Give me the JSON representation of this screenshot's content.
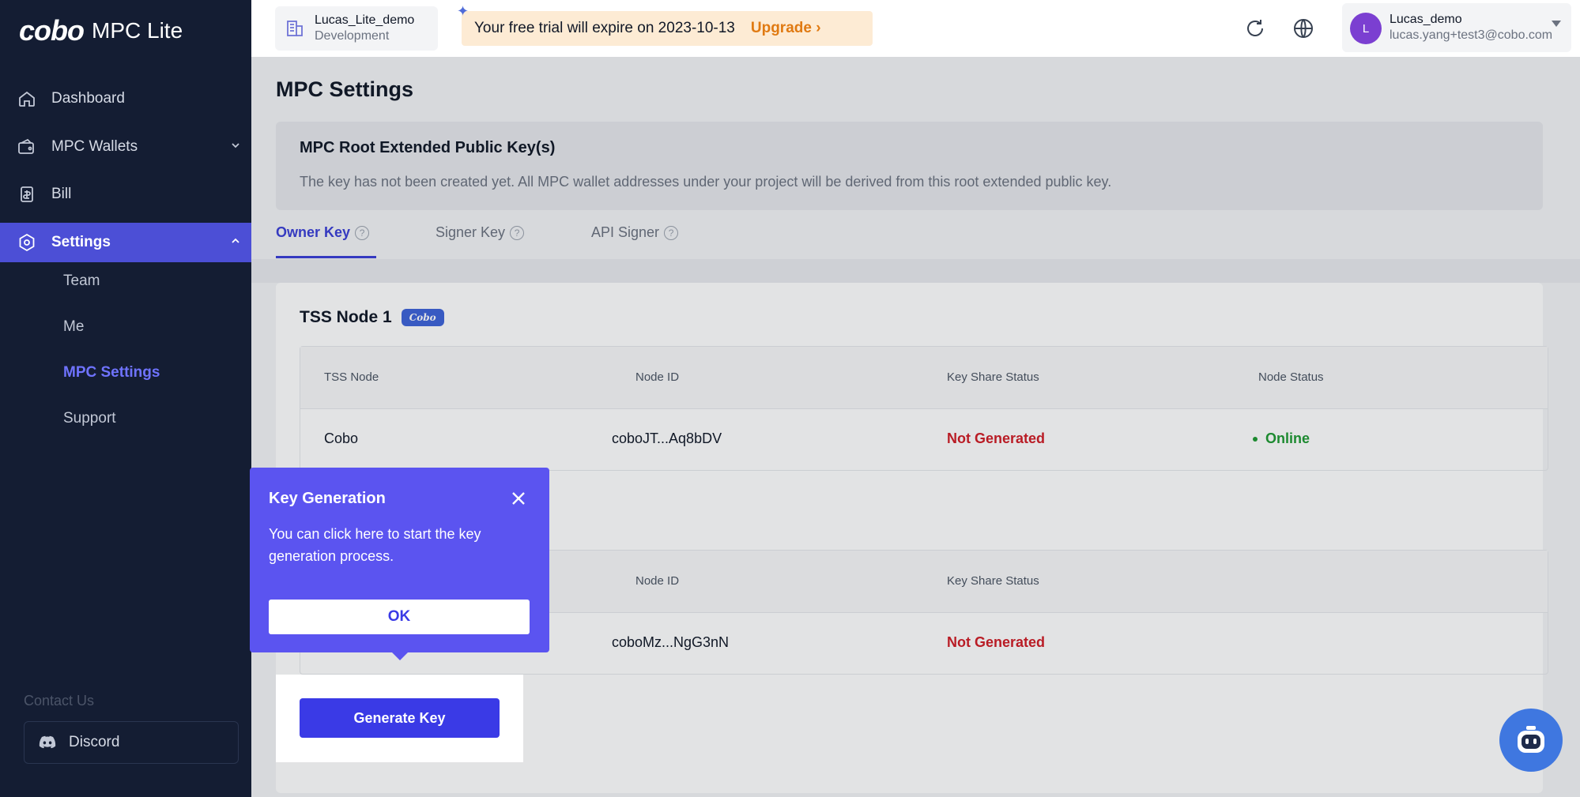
{
  "brand": {
    "mark": "cobo",
    "product": "MPC Lite"
  },
  "sidebar": {
    "items": [
      {
        "label": "Dashboard",
        "icon": "home-icon"
      },
      {
        "label": "MPC Wallets",
        "icon": "wallet-icon"
      },
      {
        "label": "Bill",
        "icon": "bill-icon"
      },
      {
        "label": "Settings",
        "icon": "settings-icon"
      }
    ],
    "sub_items": [
      "Team",
      "Me",
      "MPC Settings",
      "Support"
    ],
    "contact_label": "Contact Us",
    "discord_label": "Discord"
  },
  "topbar": {
    "project_name": "Lucas_Lite_demo",
    "project_env": "Development",
    "trial_text": "Your free trial will expire on 2023-10-13",
    "upgrade_label": "Upgrade",
    "user_name": "Lucas_demo",
    "user_email": "lucas.yang+test3@cobo.com",
    "avatar_letter": "L"
  },
  "main": {
    "title": "MPC Settings",
    "root_key_title": "MPC Root Extended Public Key(s)",
    "root_key_desc": "The key has not been created yet. All MPC wallet addresses under your project will be derived from this root extended public key.",
    "tabs": [
      {
        "label": "Owner Key"
      },
      {
        "label": "Signer Key"
      },
      {
        "label": "API Signer"
      }
    ],
    "node_title": "TSS Node 1",
    "node_badge": "Cobo",
    "table1": {
      "headers": [
        "TSS Node",
        "Node ID",
        "Key Share Status",
        "Node Status"
      ],
      "row": {
        "node": "Cobo",
        "node_id": "coboJT...Aq8bDV",
        "key_status": "Not Generated",
        "node_status": "Online"
      }
    },
    "table2": {
      "headers": [
        "Node ID",
        "Key Share Status"
      ],
      "row": {
        "node_id": "coboMz...NgG3nN",
        "key_status": "Not Generated"
      }
    },
    "generate_label": "Generate Key"
  },
  "popover": {
    "title": "Key Generation",
    "body": "You can click here to start the key generation process.",
    "ok_label": "OK"
  }
}
